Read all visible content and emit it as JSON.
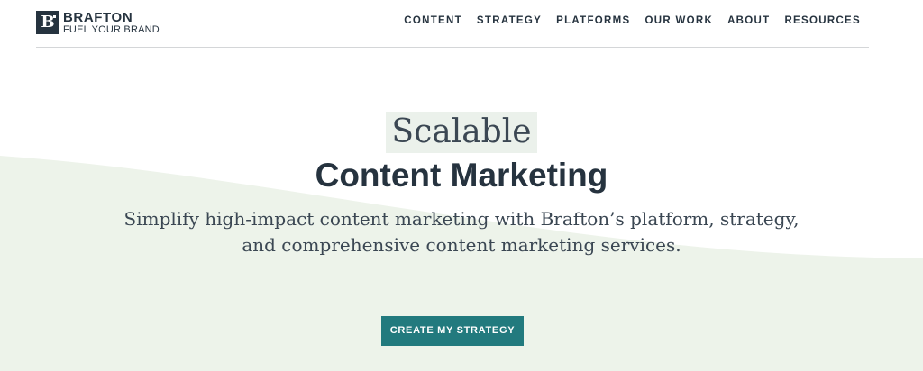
{
  "brand": {
    "mark": "B",
    "name": "BRAFTON",
    "tagline": "FUEL YOUR BRAND"
  },
  "nav": {
    "items": [
      {
        "label": "CONTENT"
      },
      {
        "label": "STRATEGY"
      },
      {
        "label": "PLATFORMS"
      },
      {
        "label": "OUR WORK"
      },
      {
        "label": "ABOUT"
      },
      {
        "label": "RESOURCES"
      }
    ]
  },
  "hero": {
    "eyebrow": "Scalable",
    "title": "Content Marketing",
    "subtitle_line1": "Simplify high-impact content marketing with Brafton’s platform, strategy,",
    "subtitle_line2": "and comprehensive content marketing services.",
    "cta_label": "CREATE MY STRATEGY"
  },
  "colors": {
    "text_dark": "#26333f",
    "accent_teal": "#227a7e",
    "wave_tint": "#edf3ea",
    "divider": "#d4d6d8"
  }
}
